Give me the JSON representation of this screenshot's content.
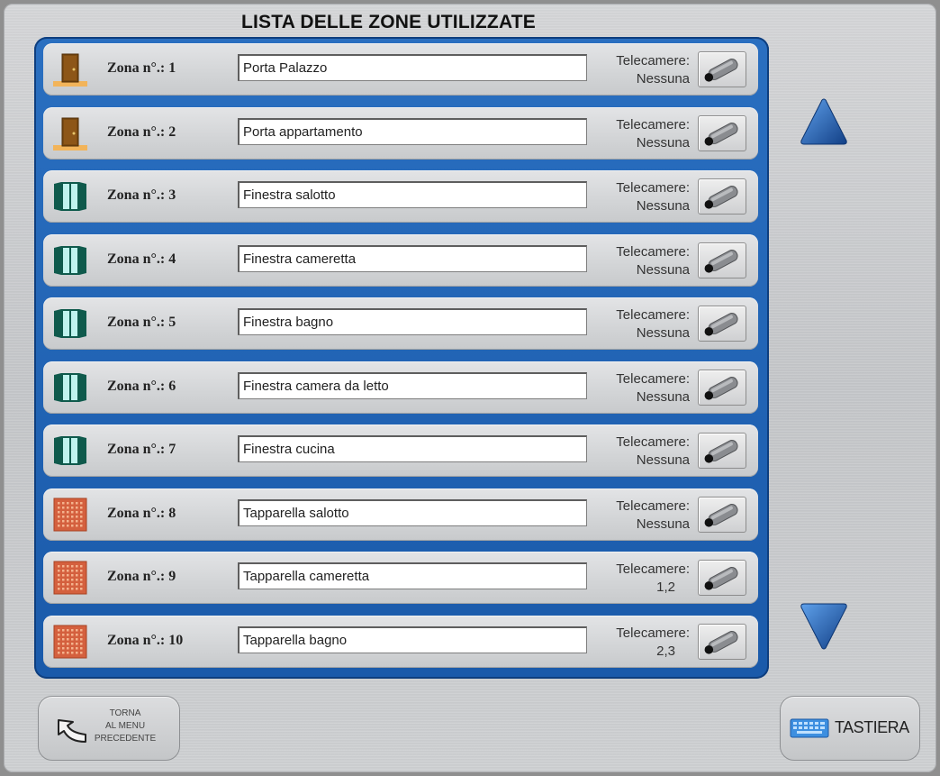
{
  "header": {
    "title": "LISTA DELLE ZONE UTILIZZATE"
  },
  "zones": [
    {
      "label": "Zona n°.: 1",
      "name": "Porta Palazzo",
      "camera_label": "Telecamere:",
      "cameras": "Nessuna",
      "icon": "door-icon"
    },
    {
      "label": "Zona n°.: 2",
      "name": "Porta appartamento",
      "camera_label": "Telecamere:",
      "cameras": "Nessuna",
      "icon": "door-icon"
    },
    {
      "label": "Zona n°.: 3",
      "name": "Finestra salotto",
      "camera_label": "Telecamere:",
      "cameras": "Nessuna",
      "icon": "window-icon"
    },
    {
      "label": "Zona n°.: 4",
      "name": "Finestra cameretta",
      "camera_label": "Telecamere:",
      "cameras": "Nessuna",
      "icon": "window-icon"
    },
    {
      "label": "Zona n°.: 5",
      "name": "Finestra bagno",
      "camera_label": "Telecamere:",
      "cameras": "Nessuna",
      "icon": "window-icon"
    },
    {
      "label": "Zona n°.: 6",
      "name": "Finestra camera da letto",
      "camera_label": "Telecamere:",
      "cameras": "Nessuna",
      "icon": "window-icon"
    },
    {
      "label": "Zona n°.: 7",
      "name": "Finestra cucina",
      "camera_label": "Telecamere:",
      "cameras": "Nessuna",
      "icon": "window-icon"
    },
    {
      "label": "Zona n°.: 8",
      "name": "Tapparella salotto",
      "camera_label": "Telecamere:",
      "cameras": "Nessuna",
      "icon": "shutter-icon"
    },
    {
      "label": "Zona n°.: 9",
      "name": "Tapparella cameretta",
      "camera_label": "Telecamere:",
      "cameras": "1,2",
      "icon": "shutter-icon"
    },
    {
      "label": "Zona n°.: 10",
      "name": "Tapparella bagno",
      "camera_label": "Telecamere:",
      "cameras": "2,3",
      "icon": "shutter-icon"
    }
  ],
  "scroll": {
    "up_icon": "triangle-up-icon",
    "down_icon": "triangle-down-icon"
  },
  "back_button": {
    "line1": "TORNA",
    "line2": "AL MENU",
    "line3": "PRECEDENTE",
    "icon": "return-arrow-icon"
  },
  "keyboard_button": {
    "label": "TASTIERA",
    "icon": "keyboard-icon"
  },
  "colors": {
    "frame_blue": "#1f63b5",
    "arrow_blue": "#1f5fb3",
    "door_brown": "#7a4a12",
    "window_teal": "#0f5a4c",
    "shutter_orange": "#d4603e"
  }
}
